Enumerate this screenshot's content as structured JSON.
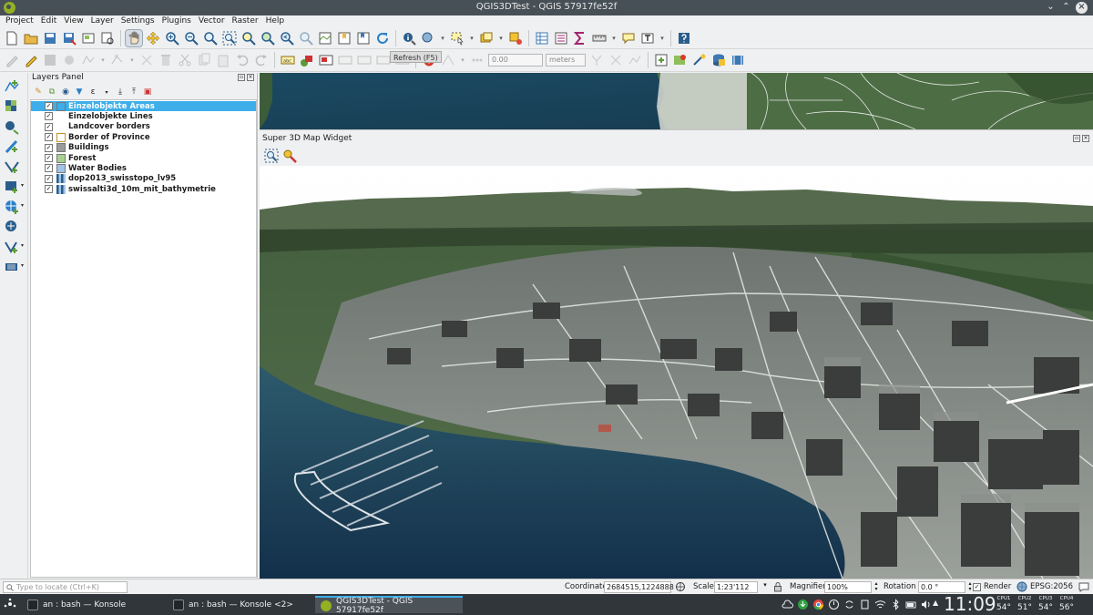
{
  "window": {
    "title": "QGIS3DTest - QGIS 57917fe52f"
  },
  "menu": [
    "Project",
    "Edit",
    "View",
    "Layer",
    "Settings",
    "Plugins",
    "Vector",
    "Raster",
    "Help"
  ],
  "toolbar": {
    "tooltip": "Refresh (F5)",
    "snap_value": "0.00",
    "snap_units": "meters"
  },
  "layers_panel": {
    "title": "Layers Panel",
    "layers": [
      {
        "name": "Einzelobjekte Areas",
        "checked": true,
        "selected": true,
        "swatch": "#3daee9"
      },
      {
        "name": "Einzelobjekte Lines",
        "checked": true,
        "selected": false,
        "swatch": ""
      },
      {
        "name": "Landcover borders",
        "checked": true,
        "selected": false,
        "swatch": ""
      },
      {
        "name": "Border of Province",
        "checked": true,
        "selected": false,
        "swatch": "#ffffff"
      },
      {
        "name": "Buildings",
        "checked": true,
        "selected": false,
        "swatch": "#9a9a9a"
      },
      {
        "name": "Forest",
        "checked": true,
        "selected": false,
        "swatch": "#a9d18e"
      },
      {
        "name": "Water Bodies",
        "checked": true,
        "selected": false,
        "swatch": "#9fc4e8"
      },
      {
        "name": "dop2013_swisstopo_lv95",
        "checked": true,
        "selected": false,
        "swatch": "raster"
      },
      {
        "name": "swissalti3d_10m_mit_bathymetrie",
        "checked": true,
        "selected": false,
        "swatch": "raster"
      }
    ]
  },
  "widget3d": {
    "title": "Super 3D Map Widget"
  },
  "status": {
    "locate_placeholder": "Type to locate (Ctrl+K)",
    "coordinate_label": "Coordinate",
    "coordinate": "2684515,1224888",
    "scale_label": "Scale",
    "scale": "1:23'112",
    "magnifier_label": "Magnifier",
    "magnifier": "100%",
    "rotation_label": "Rotation",
    "rotation": "0.0 °",
    "render_label": "Render",
    "crs": "EPSG:2056"
  },
  "taskbar": {
    "tasks": [
      "an : bash — Konsole",
      "an : bash — Konsole <2>",
      "QGIS3DTest - QGIS 57917fe52f"
    ],
    "clock": "11:09",
    "cpus": [
      {
        "name": "CPU1",
        "temp": "54°"
      },
      {
        "name": "CPU2",
        "temp": "51°"
      },
      {
        "name": "CPU3",
        "temp": "54°"
      },
      {
        "name": "CPU4",
        "temp": "56°"
      }
    ]
  },
  "colors": {
    "accent": "#3daee9",
    "water": "#1f3f5c",
    "taskbar": "#31363b",
    "titlebar": "#475057"
  }
}
